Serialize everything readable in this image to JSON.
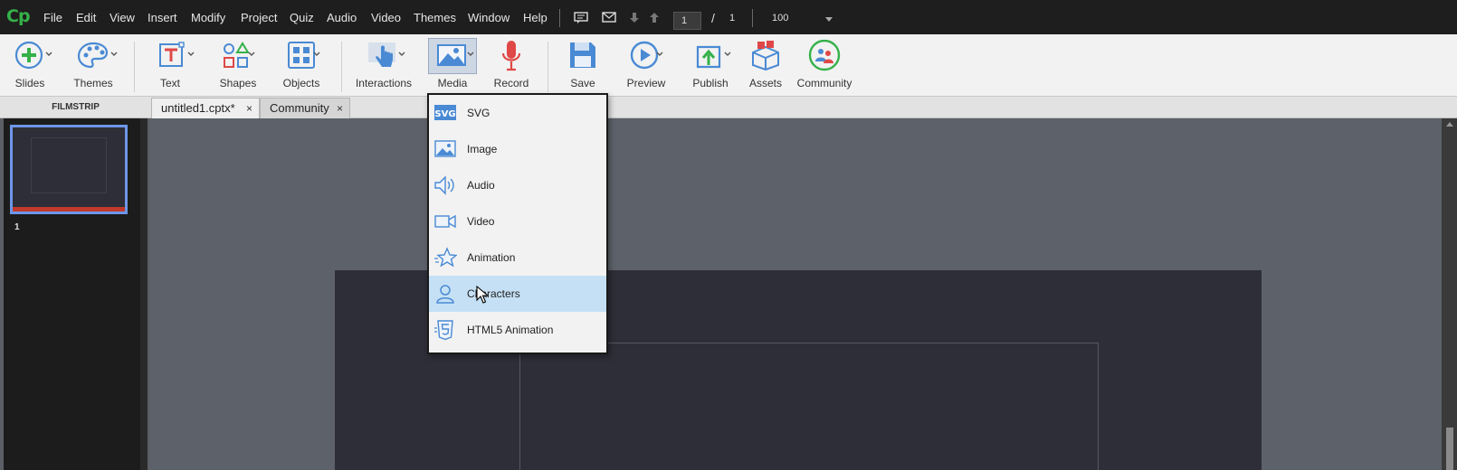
{
  "app": {
    "logo": "Cp"
  },
  "menubar": {
    "items": [
      "File",
      "Edit",
      "View",
      "Insert",
      "Modify",
      "Project",
      "Quiz",
      "Audio",
      "Video",
      "Themes",
      "Window",
      "Help"
    ],
    "page_current": "1",
    "page_separator": "/",
    "page_total": "1",
    "zoom": "100"
  },
  "toolbar": {
    "slides": "Slides",
    "themes": "Themes",
    "text": "Text",
    "shapes": "Shapes",
    "objects": "Objects",
    "interactions": "Interactions",
    "media": "Media",
    "record": "Record",
    "save": "Save",
    "preview": "Preview",
    "publish": "Publish",
    "assets": "Assets",
    "community": "Community"
  },
  "filmstrip": {
    "title": "FILMSTRIP",
    "slide_number": "1"
  },
  "tabs": [
    {
      "label": "untitled1.cptx*",
      "close": "×"
    },
    {
      "label": "Community",
      "close": "×"
    }
  ],
  "media_menu": {
    "svg_badge": "SVG",
    "items": [
      "SVG",
      "Image",
      "Audio",
      "Video",
      "Animation",
      "Characters",
      "HTML5 Animation"
    ],
    "hovered": "Characters"
  },
  "colors": {
    "brand_green": "#35b149",
    "accent_blue": "#6d96e8",
    "hover_blue": "#c5e0f5",
    "record_red": "#e04848"
  }
}
